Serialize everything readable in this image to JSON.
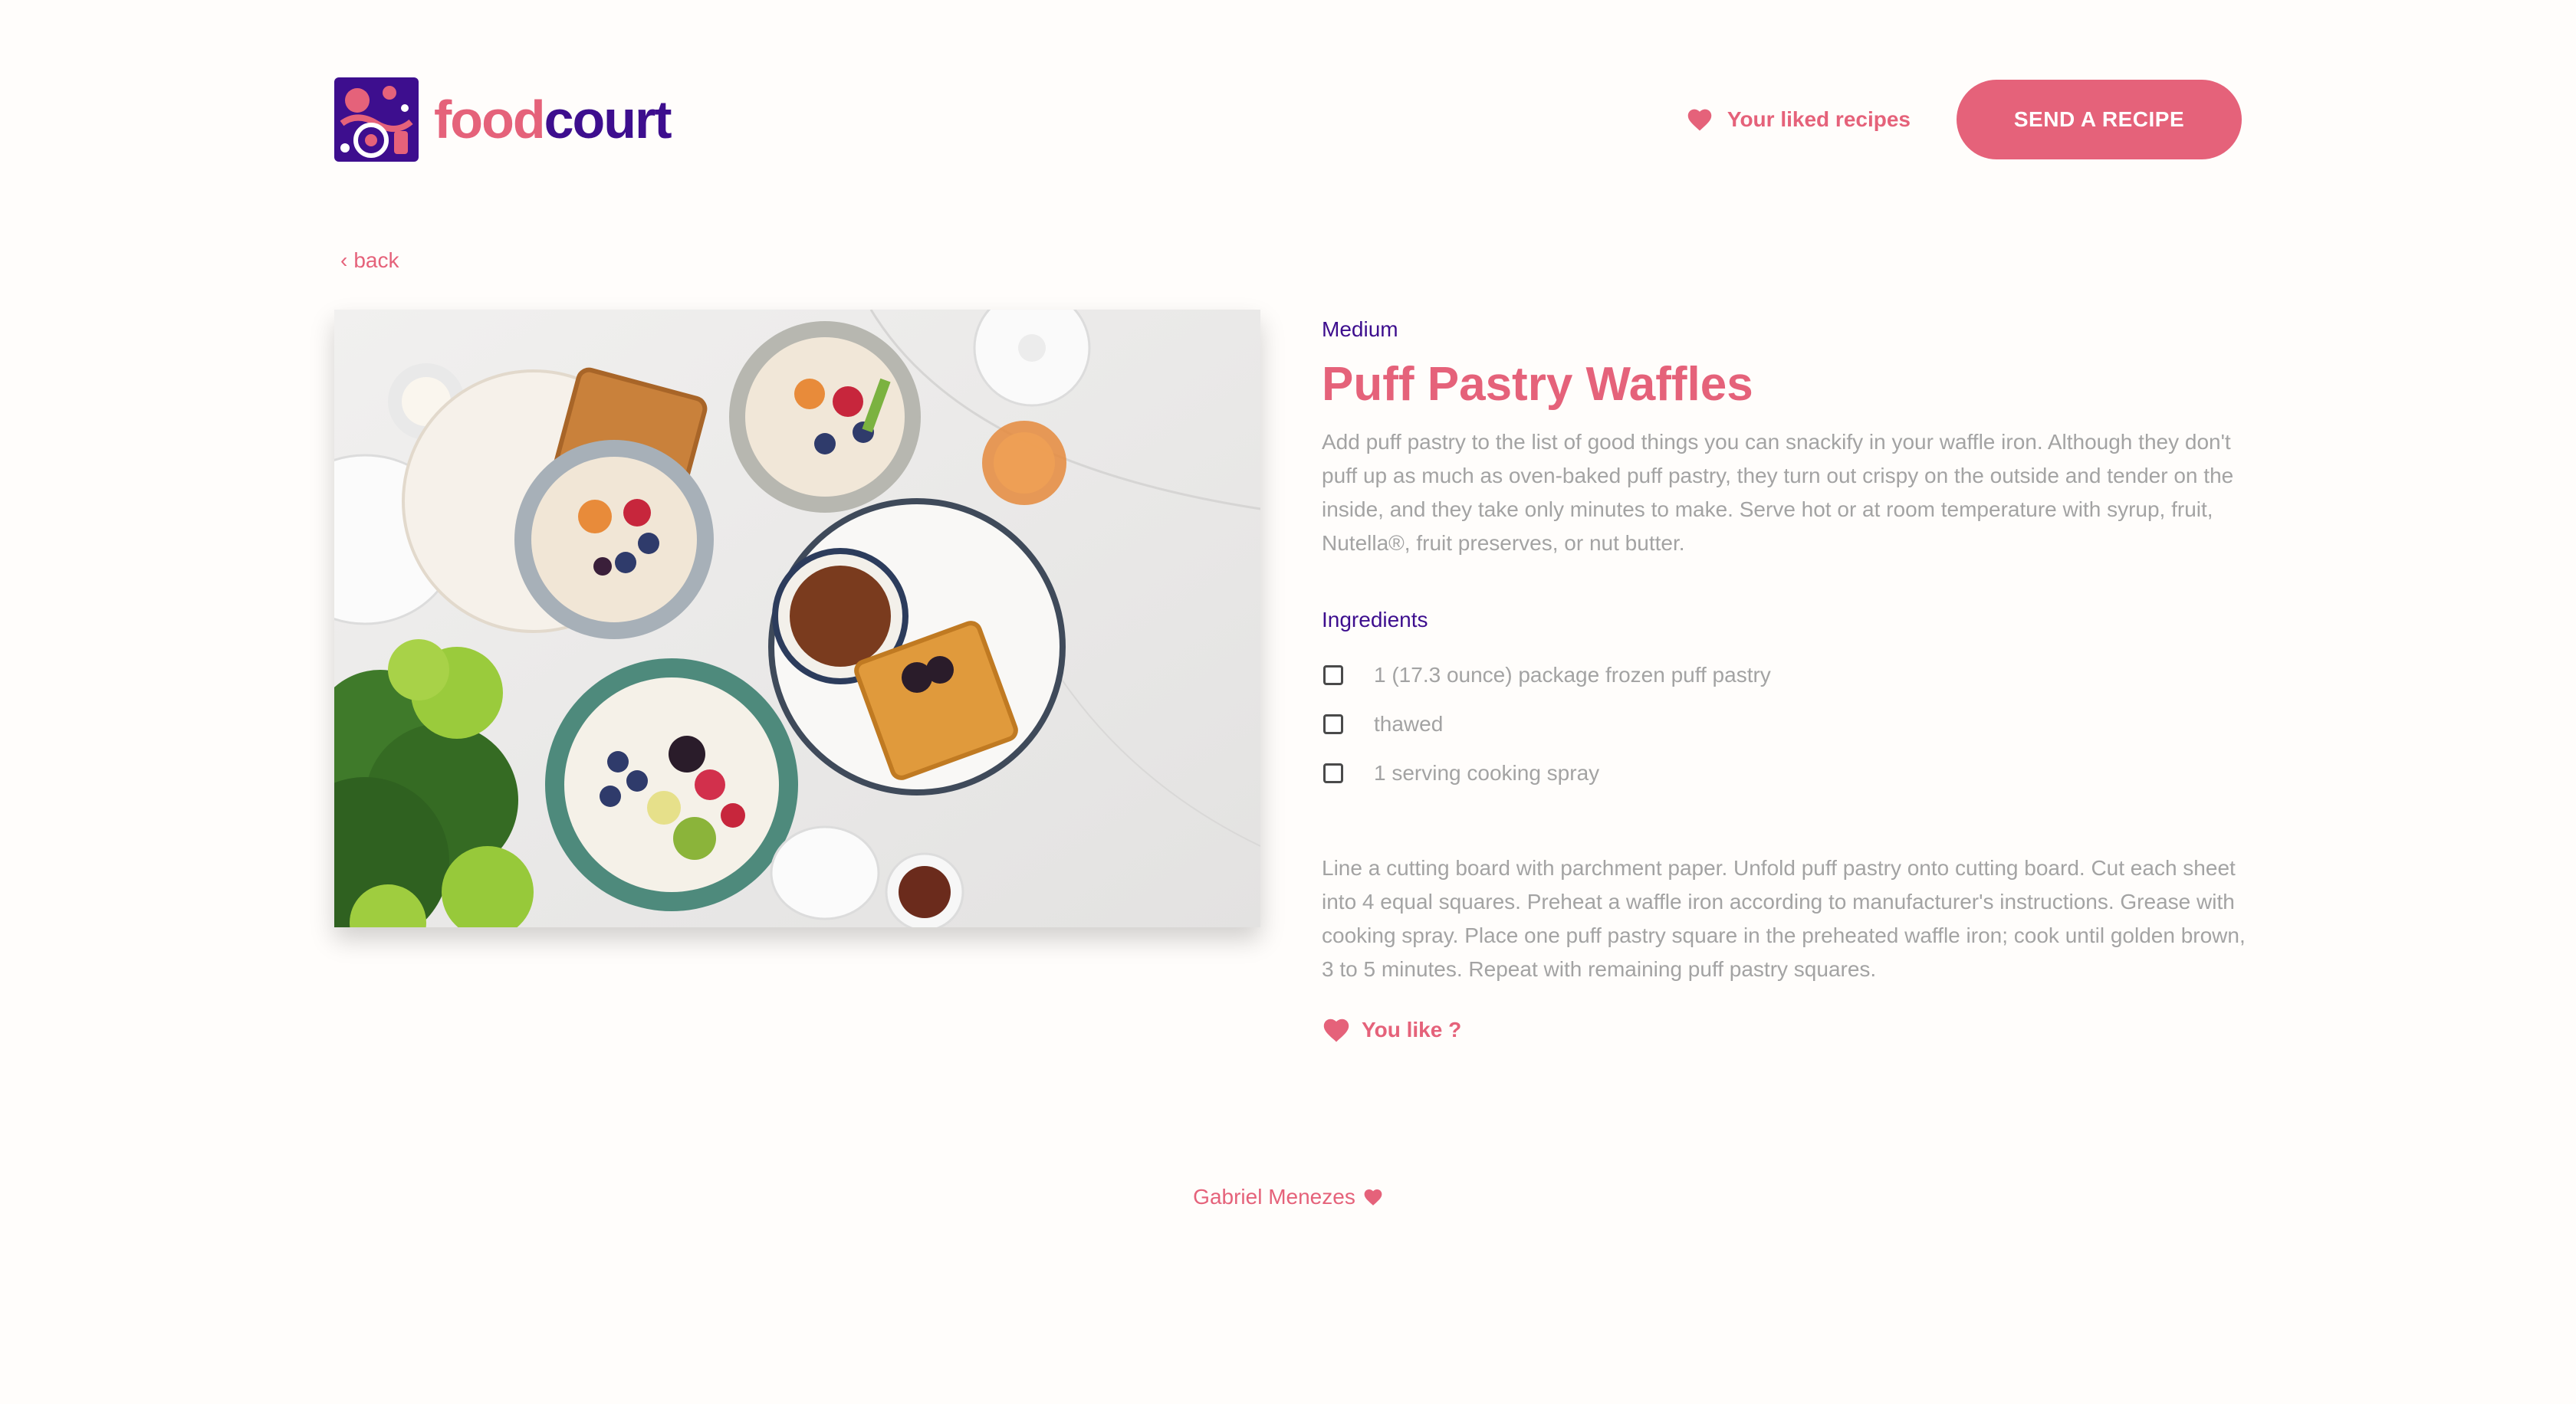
{
  "header": {
    "logo": {
      "part1": "food",
      "part2": "court",
      "icon": "foodcourt-logo-icon"
    },
    "liked_link": {
      "label": "Your liked recipes",
      "icon": "heart-icon"
    },
    "send_button": {
      "label": "SEND A RECIPE"
    }
  },
  "back": {
    "label": "back",
    "icon": "chevron-left-icon"
  },
  "recipe": {
    "image": "brunch-table-photo",
    "difficulty": "Medium",
    "title": "Puff Pastry Waffles",
    "description": "Add puff pastry to the list of good things you can snackify in your waffle iron. Although they don't puff up as much as oven-baked puff pastry, they turn out crispy on the outside and tender on the inside, and they take only minutes to make. Serve hot or at room temperature with syrup, fruit, Nutella®, fruit preserves, or nut butter.",
    "ingredients_label": "Ingredients",
    "ingredients": [
      {
        "text": "1 (17.3 ounce) package frozen puff pastry",
        "checked": false
      },
      {
        "text": "thawed",
        "checked": false
      },
      {
        "text": "1 serving cooking spray",
        "checked": false
      }
    ],
    "instructions": "Line a cutting board with parchment paper. Unfold puff pastry onto cutting board. Cut each sheet into 4 equal squares. Preheat a waffle iron according to manufacturer's instructions. Grease with cooking spray. Place one puff pastry square in the preheated waffle iron; cook until golden brown, 3 to 5 minutes. Repeat with remaining puff pastry squares.",
    "like_label": "You like ?"
  },
  "footer": {
    "author": "Gabriel Menezes",
    "icon": "heart-icon"
  },
  "colors": {
    "accent": "#e5627a",
    "brand_dark": "#3d0e8e",
    "muted_text": "#a3a3a3",
    "background": "#fffdfb"
  }
}
